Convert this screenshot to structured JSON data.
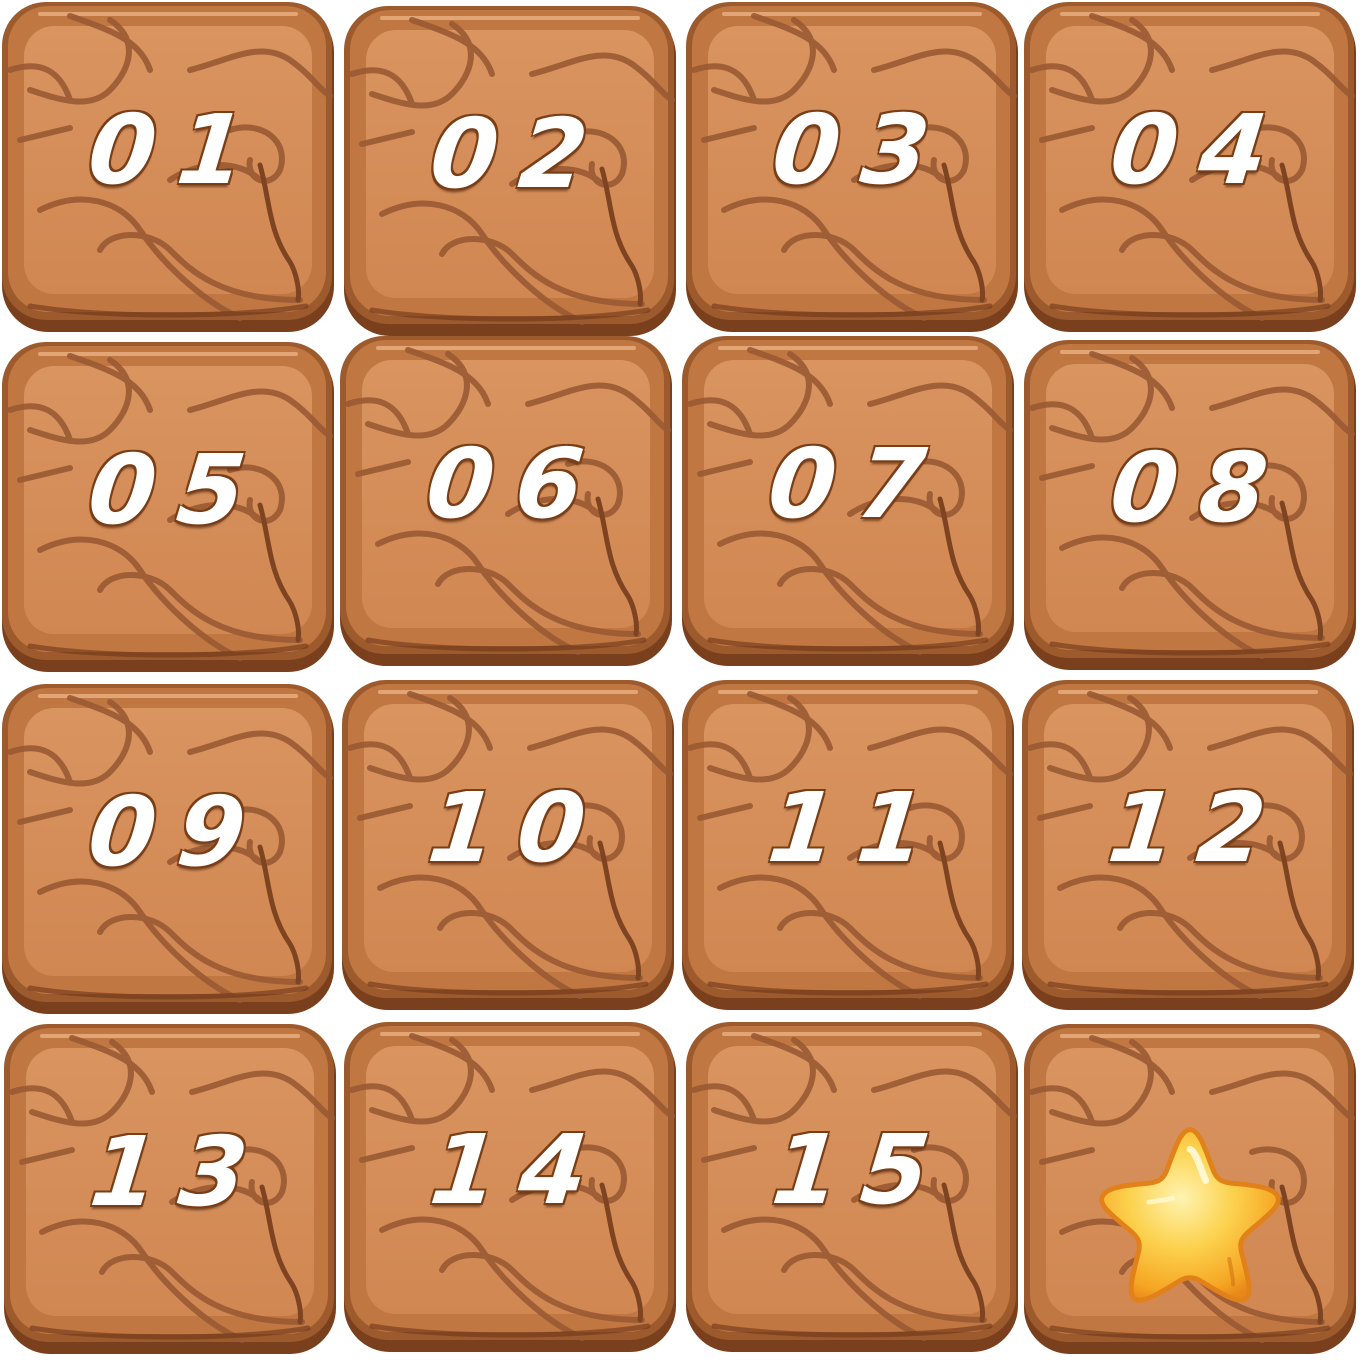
{
  "board": {
    "tiles": [
      {
        "label": "01"
      },
      {
        "label": "02"
      },
      {
        "label": "03"
      },
      {
        "label": "04"
      },
      {
        "label": "05"
      },
      {
        "label": "06"
      },
      {
        "label": "07"
      },
      {
        "label": "08"
      },
      {
        "label": "09"
      },
      {
        "label": "10"
      },
      {
        "label": "11"
      },
      {
        "label": "12"
      },
      {
        "label": "13"
      },
      {
        "label": "14"
      },
      {
        "label": "15"
      },
      {
        "label": "",
        "icon": "star-icon"
      }
    ]
  },
  "colors": {
    "wood_edge_dark": "#7a3f1c",
    "wood_edge": "#9c5a2d",
    "wood_bevel": "#c07741",
    "wood_face": "#d18752",
    "grain": "#9a5a33",
    "star_fill": "#fbc43a",
    "star_edge": "#e58b17",
    "number_fill": "#ffffff"
  }
}
